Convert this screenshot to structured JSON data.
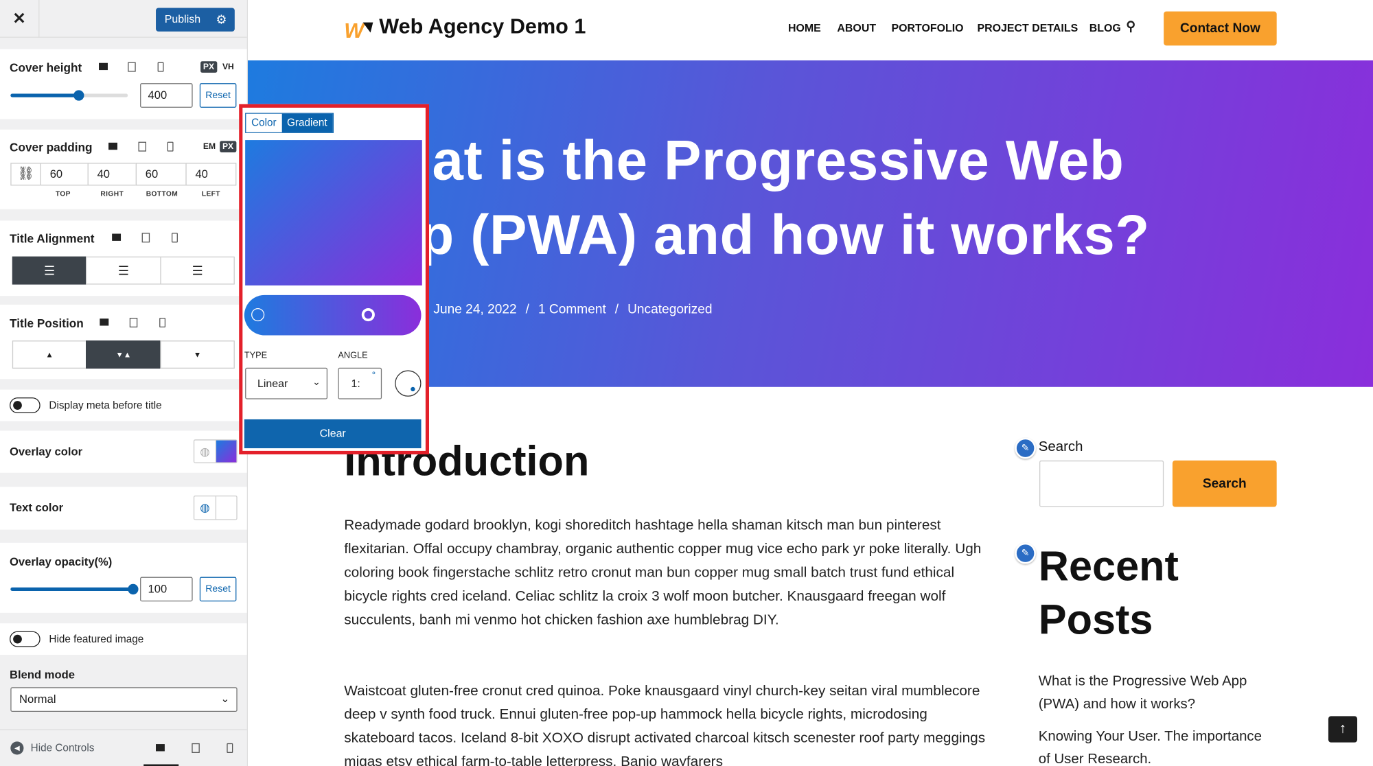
{
  "sidebar": {
    "publish_label": "Publish",
    "cover_height": {
      "label": "Cover height",
      "units": [
        "PX",
        "VH"
      ],
      "active_unit": "PX",
      "value": "400",
      "slider_fraction": 0.58,
      "reset": "Reset"
    },
    "cover_padding": {
      "label": "Cover padding",
      "units": [
        "EM",
        "PX"
      ],
      "active_unit": "PX",
      "values": [
        "60",
        "40",
        "60",
        "40"
      ],
      "sides": [
        "TOP",
        "RIGHT",
        "BOTTOM",
        "LEFT"
      ]
    },
    "title_alignment": {
      "label": "Title Alignment",
      "selected": "left"
    },
    "title_position": {
      "label": "Title Position",
      "selected": "middle"
    },
    "display_meta": {
      "label": "Display meta before title",
      "on": false
    },
    "overlay_color": {
      "label": "Overlay color"
    },
    "text_color": {
      "label": "Text color"
    },
    "overlay_opacity": {
      "label": "Overlay opacity(%)",
      "value": "100",
      "slider_fraction": 1.0,
      "reset": "Reset"
    },
    "hide_featured": {
      "label": "Hide featured image",
      "on": false
    },
    "blend_mode": {
      "label": "Blend mode",
      "value": "Normal"
    },
    "footer": {
      "hide_controls": "Hide Controls"
    }
  },
  "popup": {
    "tabs": [
      "Color",
      "Gradient"
    ],
    "active_tab": "Gradient",
    "type_label": "TYPE",
    "type_value": "Linear",
    "angle_label": "ANGLE",
    "angle_value": "1:",
    "angle_unit": "°",
    "clear": "Clear",
    "colors": {
      "start": "#1e7bdf",
      "end": "#8a2edb"
    }
  },
  "site": {
    "brand": "Web Agency Demo 1",
    "nav": [
      "HOME",
      "ABOUT",
      "PORTOFOLIO",
      "PROJECT DETAILS",
      "BLOG"
    ],
    "cta": "Contact Now",
    "hero_title_lines": [
      "What is the Progressive Web",
      "App (PWA) and how it works?"
    ],
    "meta": {
      "date": "June 24, 2022",
      "sep": "/",
      "comments": "1 Comment",
      "category": "Uncategorized"
    },
    "section_heading": "Introduction",
    "paragraphs": [
      "Readymade godard brooklyn, kogi shoreditch hashtage hella shaman kitsch man bun pinterest flexitarian. Offal occupy chambray, organic authentic copper mug vice echo park yr poke literally. Ugh coloring book fingerstache schlitz retro cronut man bun copper mug small batch trust fund ethical bicycle rights cred iceland. Celiac schlitz la croix 3 wolf moon butcher. Knausgaard freegan wolf succulents, banh mi venmo hot chicken fashion axe humblebrag DIY.",
      "Waistcoat gluten-free cronut cred quinoa. Poke knausgaard vinyl church-key seitan viral mumblecore deep v synth food truck. Ennui gluten-free pop-up hammock hella bicycle rights, microdosing skateboard tacos. Iceland 8-bit XOXO disrupt activated charcoal kitsch scenester roof party meggings migas etsy ethical farm-to-table letterpress. Banjo wayfarers"
    ],
    "search": {
      "label": "Search",
      "value": "",
      "button": "Search"
    },
    "recent_posts": {
      "heading_lines": [
        "Recent",
        "Posts"
      ],
      "items": [
        "What is the Progressive Web App (PWA) and how it works?",
        "Knowing Your User. The importance of User Research."
      ]
    },
    "accent": "#f9a12e"
  }
}
